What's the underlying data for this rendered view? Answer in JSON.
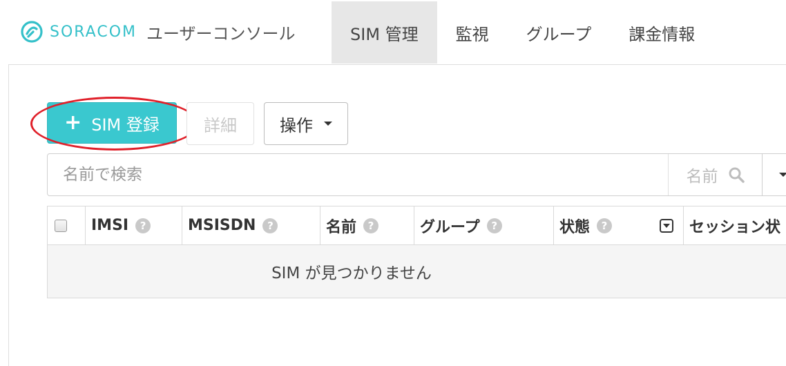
{
  "header": {
    "brand": "SORACOM",
    "subtitle": "ユーザーコンソール",
    "nav": [
      {
        "label": "SIM 管理",
        "active": true
      },
      {
        "label": "監視",
        "active": false
      },
      {
        "label": "グループ",
        "active": false
      },
      {
        "label": "課金情報",
        "active": false
      }
    ]
  },
  "toolbar": {
    "register_label": "SIM 登録",
    "detail_label": "詳細",
    "action_label": "操作"
  },
  "search": {
    "placeholder": "名前で検索",
    "field_label": "名前"
  },
  "table": {
    "columns": [
      "IMSI",
      "MSISDN",
      "名前",
      "グループ",
      "状態",
      "セッション状"
    ],
    "empty_message": "SIM が見つかりません"
  },
  "colors": {
    "accent": "#3ac8cf",
    "brand": "#34c0c9",
    "highlight": "#e0202a"
  }
}
